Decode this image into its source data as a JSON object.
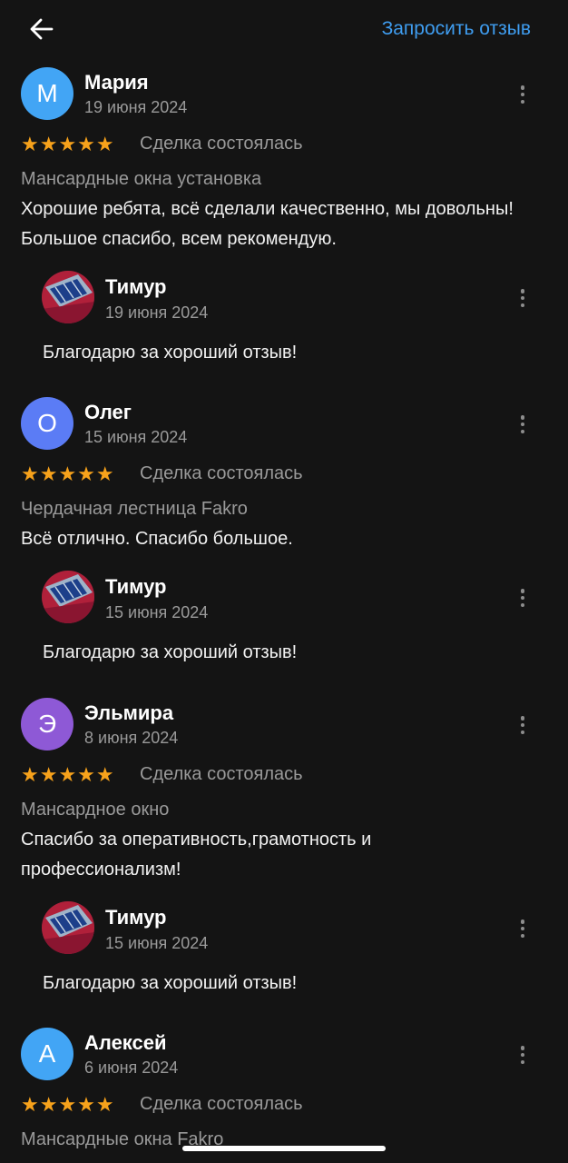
{
  "topbar": {
    "back_icon": "arrow-left-icon",
    "request_label": "Запросить отзыв",
    "accent_color": "#3f9df0"
  },
  "reviews": [
    {
      "initial": "М",
      "avatar_color": "#42a5f5",
      "author": "Мария",
      "date": "19 июня 2024",
      "stars": "★★★★★",
      "status": "Сделка состоялась",
      "service": "Мансардные окна установка",
      "text": "Хорошие ребята, всё сделали качественно, мы довольны! Большое спасибо, всем рекомендую.",
      "reply": {
        "author": "Тимур",
        "date": "19 июня 2024",
        "text": "Благодарю за хороший отзыв!"
      }
    },
    {
      "initial": "О",
      "avatar_color": "#5b7cf5",
      "author": "Олег",
      "date": "15 июня 2024",
      "stars": "★★★★★",
      "status": "Сделка состоялась",
      "service": "Чердачная лестница Fakro",
      "text": "Всё отлично.  Спасибо большое.",
      "reply": {
        "author": "Тимур",
        "date": "15 июня 2024",
        "text": "Благодарю за хороший отзыв!"
      }
    },
    {
      "initial": "Э",
      "avatar_color": "#8e59d6",
      "author": "Эльмира",
      "date": "8 июня 2024",
      "stars": "★★★★★",
      "status": "Сделка состоялась",
      "service": "Мансардное окно",
      "text": "Спасибо за оперативность,грамотность и профессионализм!",
      "reply": {
        "author": "Тимур",
        "date": "15 июня 2024",
        "text": "Благодарю за хороший отзыв!"
      }
    },
    {
      "initial": "А",
      "avatar_color": "#42a5f5",
      "author": "Алексей",
      "date": "6 июня 2024",
      "stars": "★★★★★",
      "status": "Сделка состоялась",
      "service": "Мансардные окна Fakro"
    }
  ],
  "star_color": "#f7a21b"
}
